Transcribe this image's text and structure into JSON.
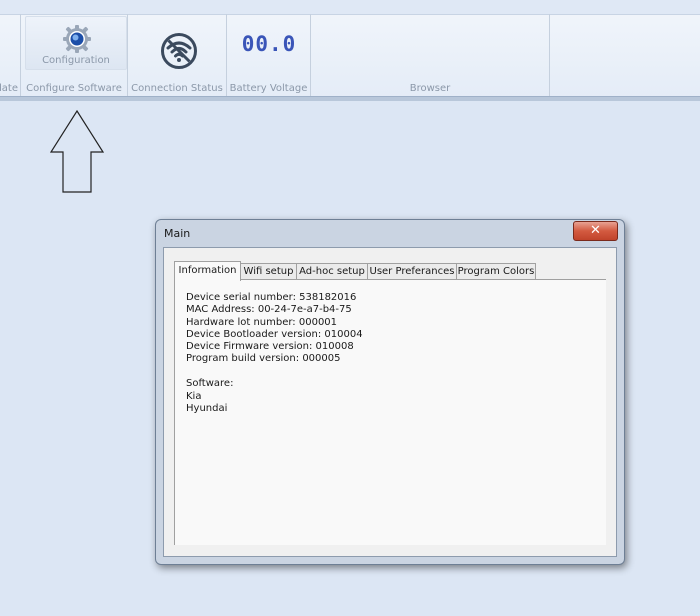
{
  "ribbon": {
    "groups": {
      "update": "date",
      "configure": "Configure Software",
      "connection": "Connection Status",
      "battery": "Battery Voltage",
      "browser": "Browser"
    },
    "config_button_label": "Configuration",
    "battery_display": "00.0",
    "icons": [
      "gear-icon",
      "wifi-off-icon",
      "up-arrow-icon"
    ]
  },
  "dialog": {
    "title": "Main",
    "close_label": "✕",
    "tabs": [
      "Information",
      "Wifi setup",
      "Ad-hoc setup",
      "User Preferances",
      "Program Colors"
    ],
    "active_tab": "Information",
    "info": {
      "serial": "Device serial number: 538182016",
      "mac": "MAC Address: 00-24-7e-a7-b4-75",
      "hardware_lot": "Hardware lot number: 000001",
      "bootloader": "Device Bootloader version: 010004",
      "firmware": "Device Firmware version: 010008",
      "program_build": "Program build version: 000005"
    },
    "software": {
      "heading": "Software:",
      "items": [
        "Kia",
        "Hyundai"
      ]
    }
  },
  "colors": {
    "background": "#dce6f4",
    "close_button": "#c0432b",
    "battery_digits": "#3a55b8"
  }
}
